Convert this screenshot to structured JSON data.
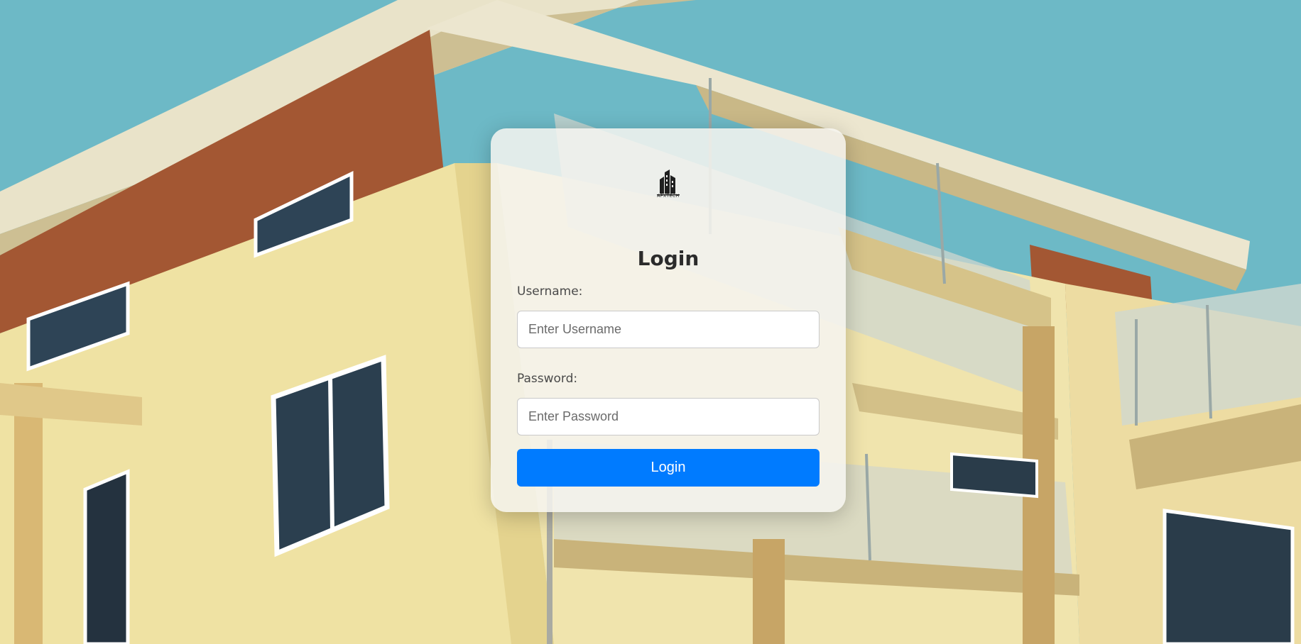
{
  "login": {
    "logo_text": "APXTECH",
    "title": "Login",
    "username_label": "Username:",
    "username_placeholder": "Enter Username",
    "username_value": "",
    "password_label": "Password:",
    "password_placeholder": "Enter Password",
    "password_value": "",
    "submit_label": "Login"
  },
  "colors": {
    "button": "#007bff",
    "sky": "#6fbfcc",
    "wall": "#efe3a8",
    "brick": "#a85a33"
  },
  "icons": {
    "logo": "building-logo-icon"
  }
}
